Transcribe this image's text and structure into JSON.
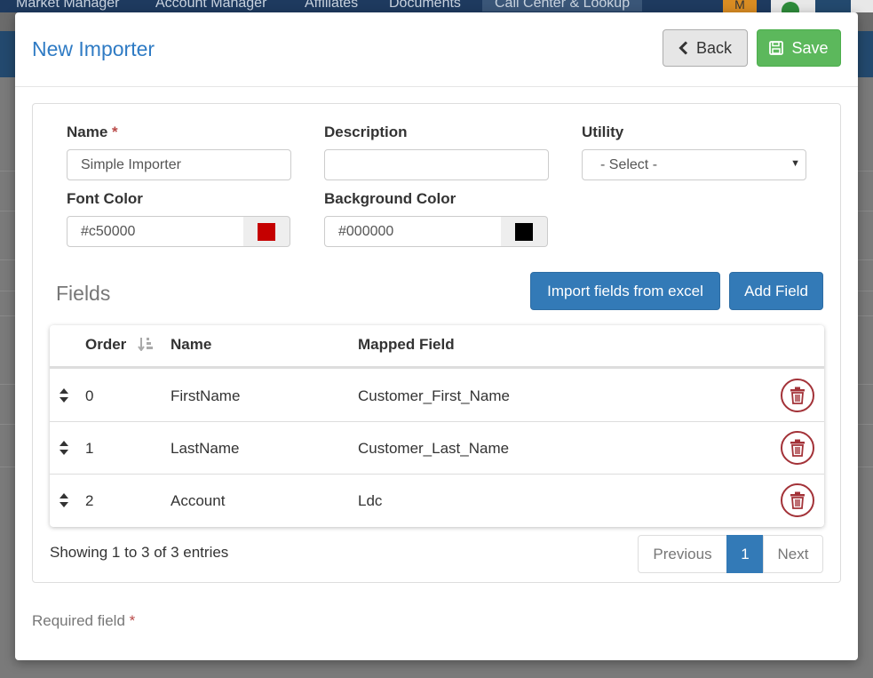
{
  "background": {
    "nav_items": [
      "Market Manager",
      "Account Manager",
      "Affiliates",
      "Documents",
      "Call Center & Lookup"
    ],
    "badge": "M"
  },
  "modal": {
    "title": "New Importer",
    "back_label": "Back",
    "save_label": "Save"
  },
  "form": {
    "name_label": "Name",
    "required_mark": "*",
    "name_value": "Simple Importer",
    "description_label": "Description",
    "description_value": "",
    "utility_label": "Utility",
    "utility_selected": "- Select -",
    "font_color_label": "Font Color",
    "font_color_value": "#c50000",
    "background_color_label": "Background Color",
    "background_color_value": "#000000"
  },
  "fields": {
    "title": "Fields",
    "import_button": "Import fields from excel",
    "add_button": "Add Field",
    "columns": {
      "order": "Order",
      "name": "Name",
      "mapped": "Mapped Field"
    },
    "rows": [
      {
        "order": "0",
        "name": "FirstName",
        "mapped": "Customer_First_Name"
      },
      {
        "order": "1",
        "name": "LastName",
        "mapped": "Customer_Last_Name"
      },
      {
        "order": "2",
        "name": "Account",
        "mapped": "Ldc"
      }
    ],
    "info": "Showing 1 to 3 of 3 entries",
    "pagination": {
      "previous": "Previous",
      "current": "1",
      "next": "Next"
    }
  },
  "footer": {
    "required_note": "Required field",
    "required_mark": "*"
  },
  "colors": {
    "title_blue": "#2f7bc4",
    "save_green": "#5cb85c",
    "primary_blue": "#337ab7",
    "delete_red": "#a33238",
    "font_swatch": "#c50000",
    "background_swatch": "#000000"
  }
}
